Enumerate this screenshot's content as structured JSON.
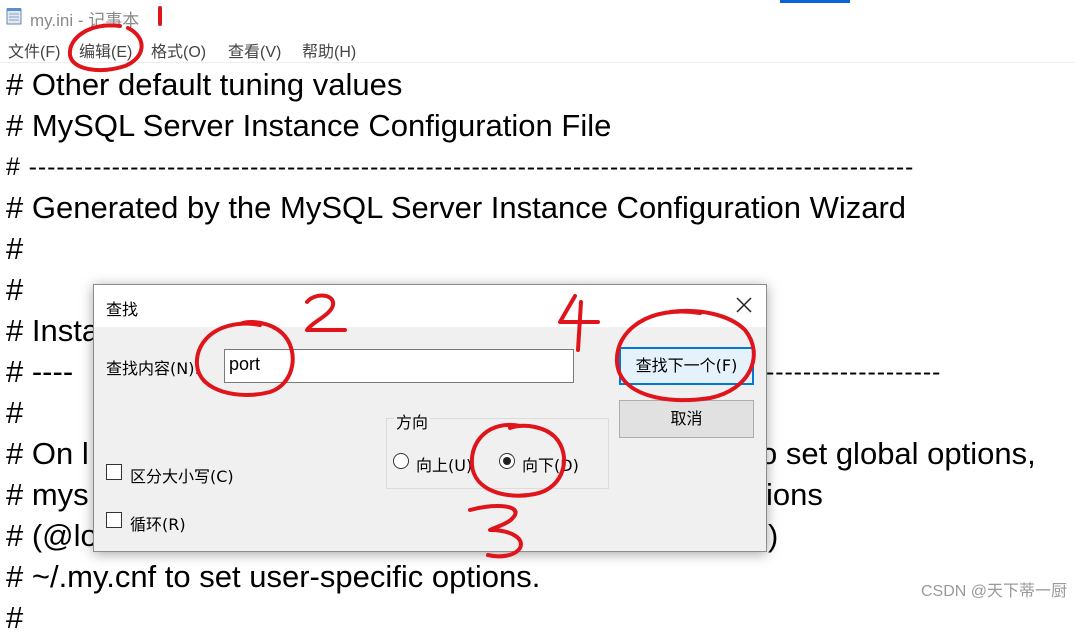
{
  "window": {
    "title": "my.ini - 记事本",
    "icon": "notepad-icon"
  },
  "menu": {
    "items": [
      "文件(F)",
      "编辑(E)",
      "格式(O)",
      "查看(V)",
      "帮助(H)"
    ]
  },
  "editor": {
    "lines": [
      "# Other default tuning values",
      "# MySQL Server Instance Configuration File",
      "# ------------------------------------------------------------------------------------------------",
      "# Generated by the MySQL Server Instance Configuration Wizard",
      "#",
      "#",
      "# Insta",
      "# ----",
      "#",
      "# On l",
      "# mys",
      "# (@lo",
      "# ~/.my.cnf to set user-specific options.",
      "#"
    ],
    "right_fragments": {
      "line2": "--------------------------------",
      "line7": "-------------------",
      "line9": "o set global options,",
      "line10": "ions",
      "line11": ")"
    }
  },
  "find_dialog": {
    "title": "查找",
    "find_label": "查找内容(N):",
    "find_value": "port",
    "find_next_button": "查找下一个(F)",
    "cancel_button": "取消",
    "direction_label": "方向",
    "direction_up": "向上(U)",
    "direction_down": "向下(D)",
    "direction_selected": "down",
    "match_case": "区分大小写(C)",
    "wrap_around": "循环(R)"
  },
  "annotations": {
    "color": "#e0151b",
    "numbers": [
      "1",
      "2",
      "3",
      "4"
    ]
  },
  "watermark": "CSDN @天下蒂一厨"
}
